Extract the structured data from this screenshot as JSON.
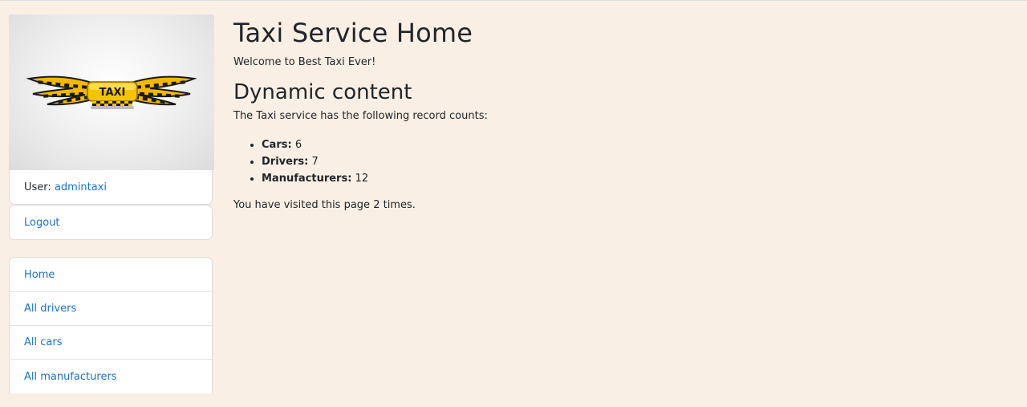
{
  "sidebar": {
    "logo": {
      "text": "TAXI",
      "icon": "taxi-logo",
      "accent": "#f5c400"
    },
    "user_label": "User:",
    "username": "admintaxi",
    "logout": "Logout",
    "nav": [
      {
        "label": "Home"
      },
      {
        "label": "All drivers"
      },
      {
        "label": "All cars"
      },
      {
        "label": "All manufacturers"
      }
    ]
  },
  "main": {
    "title": "Taxi Service Home",
    "welcome": "Welcome to Best Taxi Ever!",
    "subtitle": "Dynamic content",
    "intro": "The Taxi service has the following record counts:",
    "counts": [
      {
        "label": "Cars:",
        "value": "6"
      },
      {
        "label": "Drivers:",
        "value": "7"
      },
      {
        "label": "Manufacturers:",
        "value": "12"
      }
    ],
    "visits": "You have visited this page 2 times."
  },
  "colors": {
    "background": "#faefe5",
    "link": "#1a73c9"
  }
}
